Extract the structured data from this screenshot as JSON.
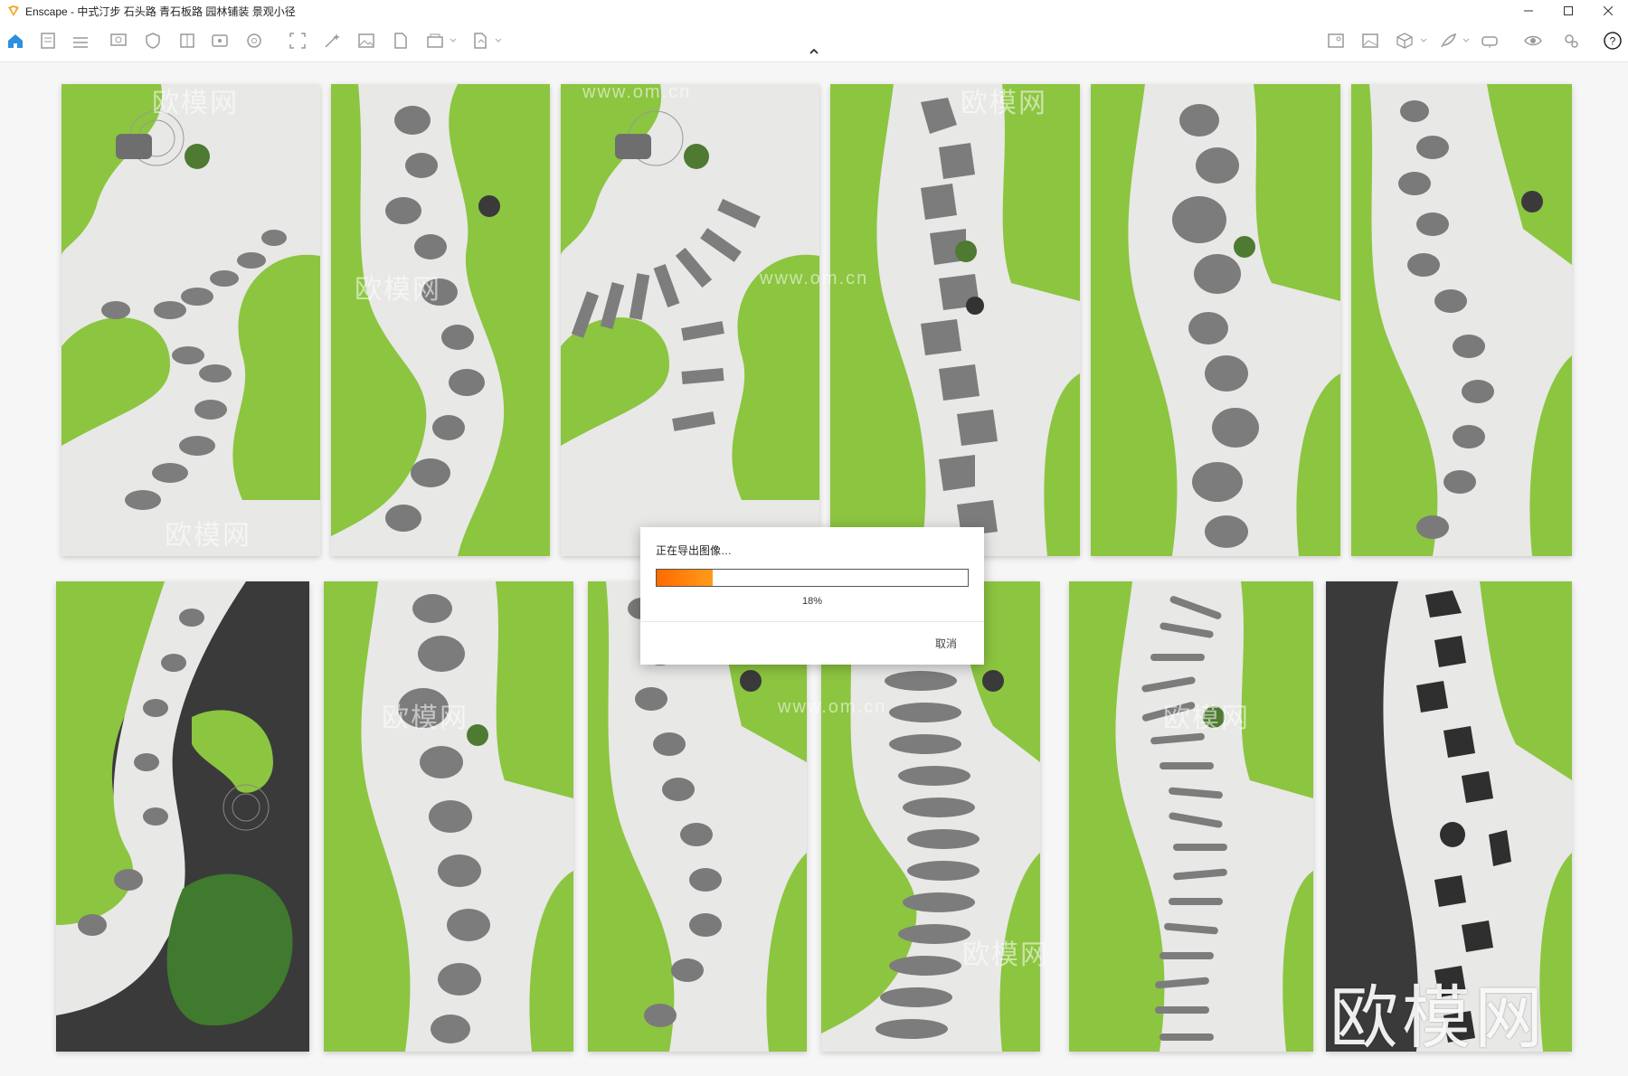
{
  "window": {
    "app_name": "Enscape",
    "title": "Enscape - 中式汀步 石头路 青石板路 园林铺装 景观小径",
    "controls": [
      "minimize-icon",
      "maximize-icon",
      "close-icon"
    ]
  },
  "toolbar": {
    "left_icons": [
      "home-icon",
      "document-icon",
      "beta-list-icon",
      "monitor-icon",
      "shield-icon",
      "book-icon",
      "info-card-icon",
      "gear-wheel-icon",
      "scan-icon",
      "magic-wand-icon",
      "image-icon",
      "file-export-icon",
      "batch-icon",
      "export-icon"
    ],
    "right_icons": [
      "map-icon",
      "gallery-icon",
      "cube-icon",
      "feather-icon",
      "vr-icon",
      "eye-icon",
      "settings-icon",
      "help-icon"
    ],
    "help_label": "?"
  },
  "watermark": {
    "brand": "欧模网",
    "domain": "www.om.cn"
  },
  "export_dialog": {
    "title": "正在导出图像…",
    "progress": 0.18,
    "progress_label": "18%",
    "cancel_label": "取消"
  }
}
